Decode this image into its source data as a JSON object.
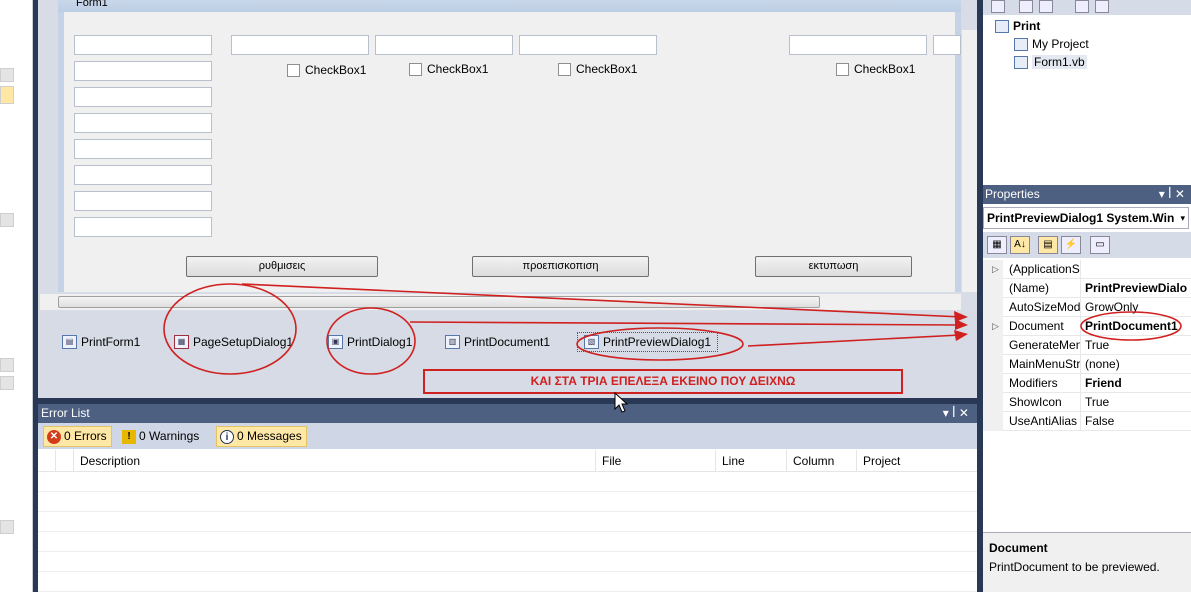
{
  "designer": {
    "form_title": "Form1",
    "checkbox_label": "CheckBox1",
    "buttons": [
      "ρυθμισεις",
      "προεπισκοπιση",
      "εκτυπωση"
    ],
    "components": [
      "PrintForm1",
      "PageSetupDialog1",
      "PrintDialog1",
      "PrintDocument1",
      "PrintPreviewDialog1"
    ],
    "annotation": "ΚΑΙ ΣΤΑ ΤΡΙΑ ΕΠΕΛΕΞΑ ΕΚΕΙΝΟ ΠΟΥ ΔΕΙΧΝΩ",
    "annotation_color": "#d02020"
  },
  "error_list": {
    "title": "Error List",
    "errors": "0 Errors",
    "warnings": "0 Warnings",
    "messages": "0 Messages",
    "columns": [
      "Description",
      "File",
      "Line",
      "Column",
      "Project"
    ]
  },
  "solution": {
    "project": "Print",
    "items": [
      "My Project",
      "Form1.vb"
    ]
  },
  "properties": {
    "title": "Properties",
    "object": "PrintPreviewDialog1  System.Win",
    "rows": [
      {
        "name": "(ApplicationS",
        "value": ""
      },
      {
        "name": "(Name)",
        "value": "PrintPreviewDialo"
      },
      {
        "name": "AutoSizeMod",
        "value": "GrowOnly"
      },
      {
        "name": "Document",
        "value": "PrintDocument1"
      },
      {
        "name": "GenerateMen",
        "value": "True"
      },
      {
        "name": "MainMenuStr",
        "value": "(none)"
      },
      {
        "name": "Modifiers",
        "value": "Friend"
      },
      {
        "name": "ShowIcon",
        "value": "True"
      },
      {
        "name": "UseAntiAlias",
        "value": "False"
      }
    ],
    "desc_title": "Document",
    "desc_text": "PrintDocument to be previewed."
  },
  "colors": {
    "title_bar": "#4d6082",
    "accent_red": "#d02020"
  }
}
